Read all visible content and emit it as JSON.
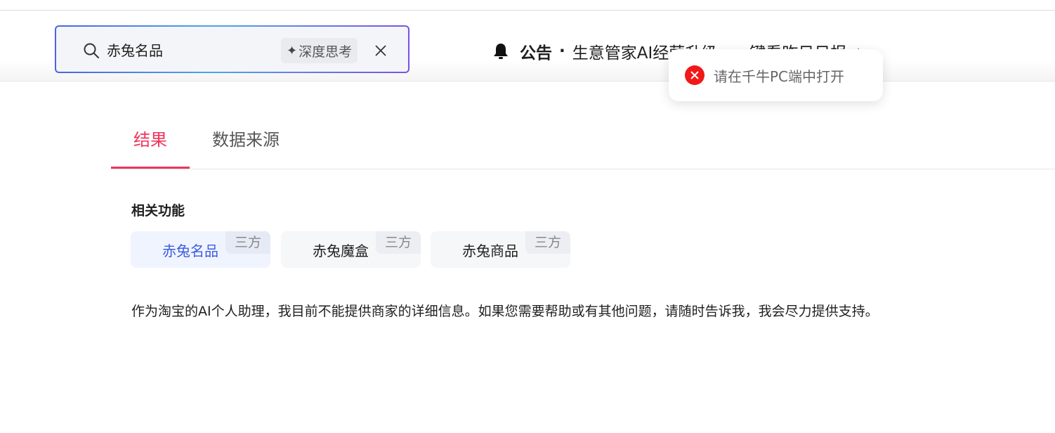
{
  "search": {
    "query": "赤兔名品",
    "deep_think_label": "深度思考"
  },
  "notice": {
    "title": "公告",
    "separator": "·",
    "text": "生意管家AI经营升级，一键看昨日日报"
  },
  "toast": {
    "message": "请在千牛PC端中打开",
    "status_color": "#f21818"
  },
  "tabs": [
    {
      "label": "结果",
      "active": true
    },
    {
      "label": "数据来源",
      "active": false
    }
  ],
  "related": {
    "title": "相关功能",
    "items": [
      {
        "label": "赤兔名品",
        "tag": "三方",
        "active": true
      },
      {
        "label": "赤兔魔盒",
        "tag": "三方",
        "active": false
      },
      {
        "label": "赤兔商品",
        "tag": "三方",
        "active": false
      }
    ]
  },
  "answer": "作为淘宝的AI个人助理，我目前不能提供商家的详细信息。如果您需要帮助或有其他问题，请随时告诉我，我会尽力提供支持。",
  "colors": {
    "accent": "#f0345c",
    "link": "#3b5ce0"
  },
  "icons": [
    "search-icon",
    "sparkle-icon",
    "close-icon",
    "bell-icon",
    "chevron-right-icon",
    "error-icon"
  ]
}
